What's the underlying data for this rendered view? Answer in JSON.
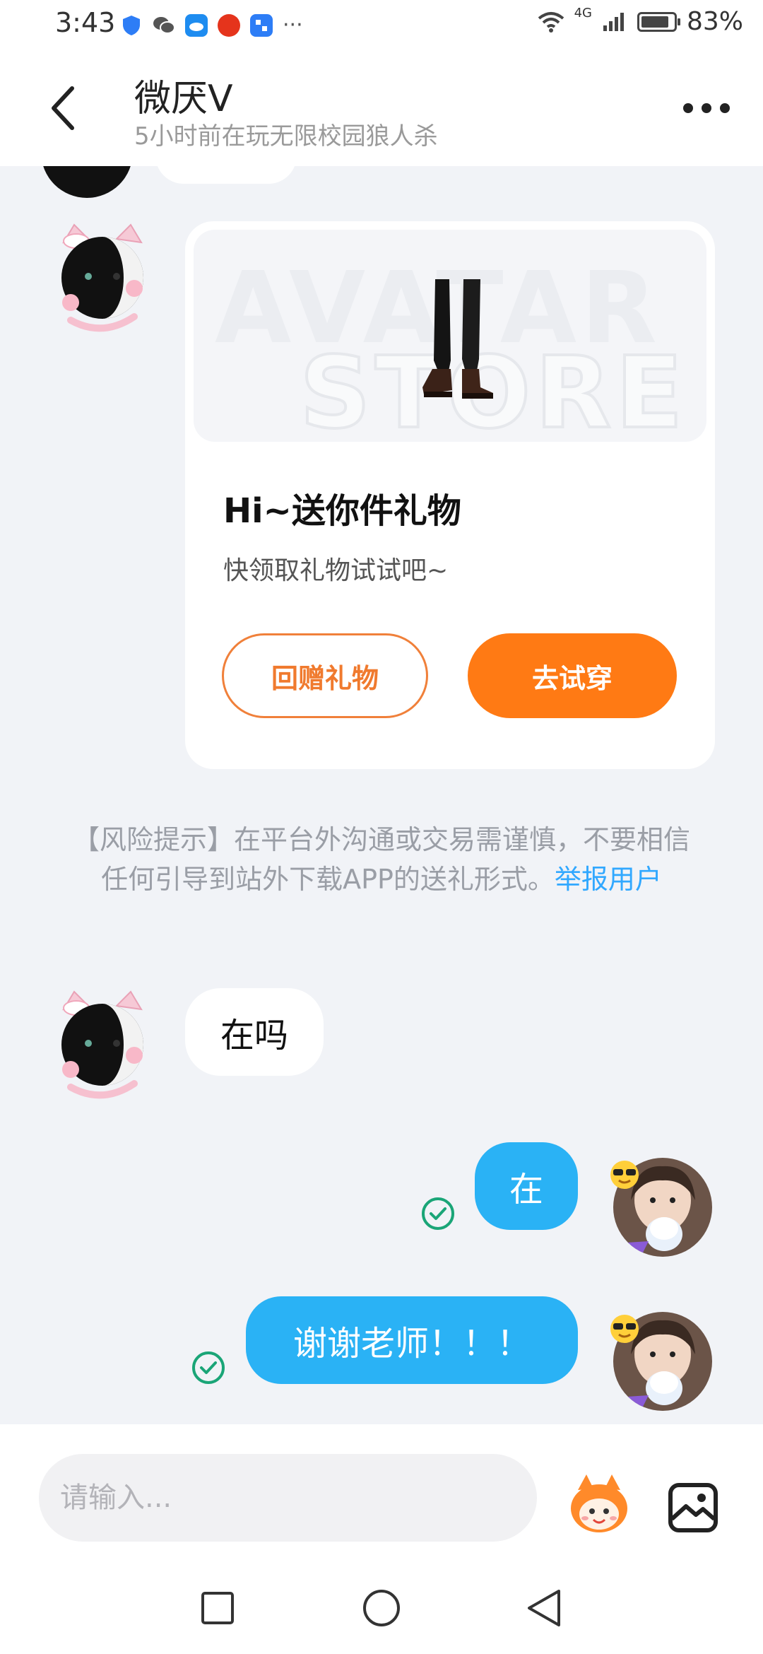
{
  "status_bar": {
    "time": "3:43",
    "network": "4G",
    "battery": "83%",
    "battery_level": 0.83,
    "app_icons": [
      "shield-icon",
      "wechat-icon",
      "weather-icon",
      "app-red-icon",
      "app-blue-icon"
    ],
    "more": "···"
  },
  "header": {
    "contact_name": "微厌V",
    "status": "5小时前在玩无限校园狼人杀"
  },
  "gift_card": {
    "banner_word1": "AVATAR",
    "banner_word2": "STORE",
    "title": "Hi~送你件礼物",
    "subtitle": "快领取礼物试试吧~",
    "return_gift_button": "回赠礼物",
    "try_on_button": "去试穿"
  },
  "risk_notice": {
    "text": "【风险提示】在平台外沟通或交易需谨慎，不要相信任何引导到站外下载APP的送礼形式。",
    "report_link": "举报用户"
  },
  "messages": [
    {
      "sender": "contact",
      "text": "在吗"
    },
    {
      "sender": "me",
      "text": "在",
      "read": true
    },
    {
      "sender": "me",
      "text": "谢谢老师！！！",
      "read": true
    }
  ],
  "input_bar": {
    "placeholder": "请输入..."
  },
  "colors": {
    "accent_orange": "#ff7a14",
    "outgoing_bubble": "#2ab2f5",
    "link_blue": "#31a8ff",
    "read_check_green": "#1aa577"
  }
}
